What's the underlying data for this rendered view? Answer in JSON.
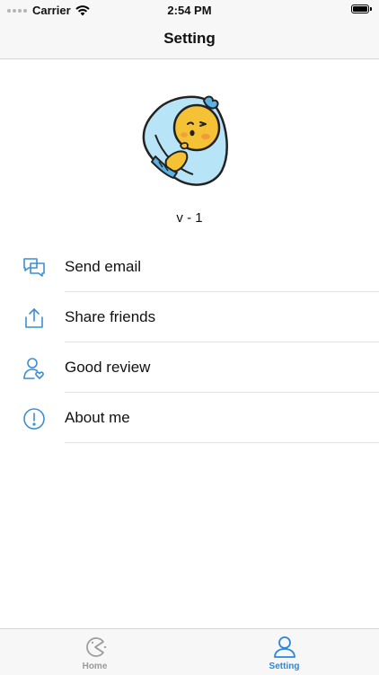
{
  "status_bar": {
    "carrier": "Carrier",
    "time": "2:54 PM"
  },
  "nav": {
    "title": "Setting"
  },
  "app": {
    "version": "v - 1"
  },
  "menu": {
    "items": [
      {
        "label": "Send email",
        "icon": "chat-bubbles-icon"
      },
      {
        "label": "Share friends",
        "icon": "share-icon"
      },
      {
        "label": "Good review",
        "icon": "user-heart-icon"
      },
      {
        "label": "About me",
        "icon": "info-circle-icon"
      }
    ]
  },
  "tab_bar": {
    "tabs": [
      {
        "label": "Home",
        "icon": "pacman-icon",
        "selected": false
      },
      {
        "label": "Setting",
        "icon": "person-icon",
        "selected": true
      }
    ]
  },
  "colors": {
    "accent": "#2d86d8",
    "inactive": "#9a9a9a",
    "icon_blue": "#3b8fd4",
    "mascot_yellow": "#f5c236",
    "mascot_blue": "#b8e4f7"
  }
}
